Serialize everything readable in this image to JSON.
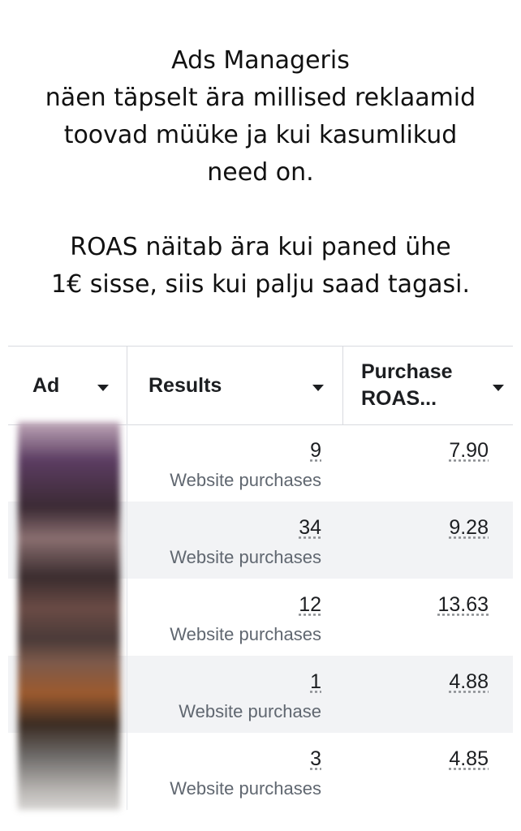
{
  "caption": {
    "lines_1": [
      "Ads Manageris",
      "näen täpselt ära millised reklaamid",
      "toovad müüke ja kui kasumlikud",
      "need on."
    ],
    "lines_2": [
      "ROAS näitab ära kui paned ühe",
      "1€ sisse, siis kui palju saad tagasi."
    ]
  },
  "table": {
    "columns": {
      "ad": "Ad",
      "results": "Results",
      "roas_line1": "Purchase",
      "roas_line2": "ROAS..."
    },
    "rows": [
      {
        "results": "9",
        "results_label": "Website purchases",
        "roas": "7.90"
      },
      {
        "results": "34",
        "results_label": "Website purchases",
        "roas": "9.28"
      },
      {
        "results": "12",
        "results_label": "Website purchases",
        "roas": "13.63"
      },
      {
        "results": "1",
        "results_label": "Website purchase",
        "roas": "4.88"
      },
      {
        "results": "3",
        "results_label": "Website purchases",
        "roas": "4.85"
      }
    ]
  },
  "icons": {
    "sort": "caret-down-icon"
  }
}
